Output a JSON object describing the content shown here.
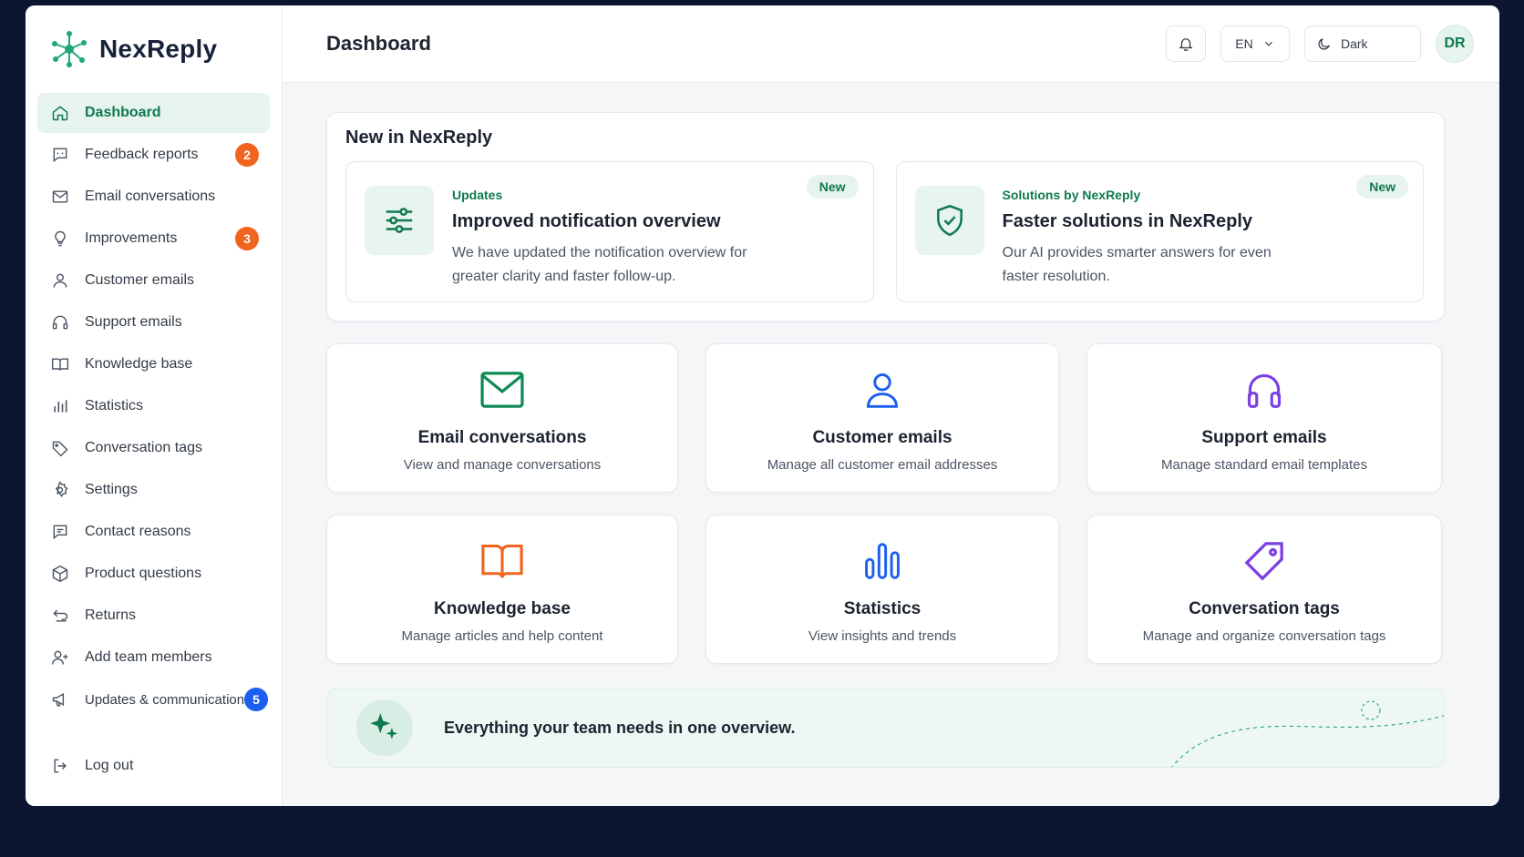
{
  "app": {
    "name": "NexReply"
  },
  "sidebar": {
    "items": [
      {
        "label": "Dashboard",
        "icon": "home-icon",
        "active": true
      },
      {
        "label": "Feedback reports",
        "icon": "feedback-icon",
        "badge": "2"
      },
      {
        "label": "Email conversations",
        "icon": "mail-icon"
      },
      {
        "label": "Improvements",
        "icon": "lightbulb-icon",
        "badge": "3"
      },
      {
        "label": "Customer emails",
        "icon": "user-icon"
      },
      {
        "label": "Support emails",
        "icon": "headphones-icon"
      },
      {
        "label": "Knowledge base",
        "icon": "book-icon"
      },
      {
        "label": "Statistics",
        "icon": "bar-chart-icon"
      },
      {
        "label": "Conversation tags",
        "icon": "tag-icon"
      },
      {
        "label": "Settings",
        "icon": "gear-icon"
      },
      {
        "label": "Contact reasons",
        "icon": "message-icon"
      },
      {
        "label": "Product questions",
        "icon": "box-icon"
      },
      {
        "label": "Returns",
        "icon": "returns-icon"
      },
      {
        "label": "Add team members",
        "icon": "user-plus-icon"
      },
      {
        "label": "Updates & communication",
        "icon": "megaphone-icon",
        "badge": "5"
      }
    ],
    "logout": "Log out"
  },
  "header": {
    "title": "Dashboard",
    "language": "EN",
    "theme": "Dark",
    "avatar_initials": "DR"
  },
  "news": {
    "title": "New in NexReply",
    "items": [
      {
        "kicker": "Updates",
        "heading": "Improved notification overview",
        "text": "We have updated the notification overview for greater clarity and faster follow-up.",
        "tag": "New"
      },
      {
        "kicker": "Solutions by NexReply",
        "heading": "Faster solutions in NexReply",
        "text": "Our AI provides smarter answers for even faster resolution.",
        "tag": "New"
      }
    ]
  },
  "tiles": [
    {
      "title": "Email conversations",
      "subtitle": "View and manage conversations",
      "icon": "mail-icon",
      "color": "#0f8a55"
    },
    {
      "title": "Customer emails",
      "subtitle": "Manage all customer email addresses",
      "icon": "user-icon",
      "color": "#1b5ff0"
    },
    {
      "title": "Support emails",
      "subtitle": "Manage standard email templates",
      "icon": "headphones-icon",
      "color": "#7b3fe4"
    },
    {
      "title": "Knowledge base",
      "subtitle": "Manage articles and help content",
      "icon": "book-icon",
      "color": "#f0641e"
    },
    {
      "title": "Statistics",
      "subtitle": "View insights and trends",
      "icon": "bar-chart-icon",
      "color": "#1b5ff0"
    },
    {
      "title": "Conversation tags",
      "subtitle": "Manage and organize conversation tags",
      "icon": "tag-icon",
      "color": "#7b3fe4"
    }
  ],
  "banner": {
    "text": "Everything your team needs in one overview."
  },
  "colors": {
    "brand": "#0f7a4e",
    "accent_green": "#1fa877",
    "badge_orange": "#f0641e",
    "badge_blue": "#1b5ff0"
  }
}
